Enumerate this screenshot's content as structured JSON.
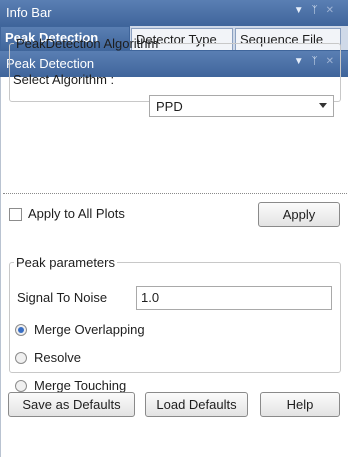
{
  "panel": {
    "title": "Info Bar"
  },
  "tabs": [
    {
      "label": "Peak Detection",
      "active": true
    },
    {
      "label": "Detector Type",
      "active": false
    },
    {
      "label": "Sequence File",
      "active": false
    }
  ],
  "subpanel": {
    "title": "Peak Detection"
  },
  "algorithm": {
    "group_label": "PeakDetection Algorithm",
    "select_label": "Select Algorithm :",
    "selected": "PPD"
  },
  "apply_all": {
    "label": "Apply to All Plots",
    "checked": false
  },
  "apply_button": "Apply",
  "peak_params": {
    "group_label": "Peak parameters",
    "snr_label": "Signal To Noise",
    "snr_value": "1.0",
    "options": [
      {
        "label": "Merge Overlapping",
        "selected": true
      },
      {
        "label": "Resolve",
        "selected": false
      },
      {
        "label": "Merge Touching",
        "selected": false
      }
    ]
  },
  "buttons": {
    "save_defaults": "Save as Defaults",
    "load_defaults": "Load Defaults",
    "help": "Help"
  },
  "colors": {
    "titlebar": "#4a6fa5",
    "selected_radio": "#3a6fc4"
  },
  "icons": [
    "dropdown-arrow-icon",
    "pin-icon",
    "close-icon"
  ]
}
